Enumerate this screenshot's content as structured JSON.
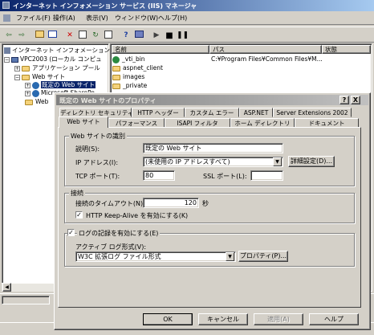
{
  "main_window": {
    "title": "インターネット インフォメーション サービス (IIS) マネージャ",
    "menu": [
      "ファイル(F)",
      "操作(A)",
      "表示(V)",
      "ウィンドウ(W)",
      "ヘルプ(H)"
    ],
    "tree": {
      "root": "インターネット インフォメーション サ",
      "computer": "VPC2003 (ローカル コンピュ",
      "app_pools": "アプリケーション プール",
      "web_sites": "Web サイト",
      "default_site": "既定の Web サイト",
      "sharepoint": "Microsoft SharePo",
      "web_ext": "Web"
    },
    "list_headers": [
      "名前",
      "パス",
      "状態"
    ],
    "list_rows": [
      {
        "name": "_vti_bin",
        "path": "C:¥Program Files¥Common Files¥M...",
        "status": ""
      },
      {
        "name": "aspnet_client",
        "path": "",
        "status": ""
      },
      {
        "name": "images",
        "path": "",
        "status": ""
      },
      {
        "name": "_private",
        "path": "",
        "status": ""
      }
    ]
  },
  "dialog": {
    "title": "既定の Web サイトのプロパティ",
    "help_btn": "?",
    "close_btn": "X",
    "tabs_back": [
      "ディレクトリ セキュリティ",
      "HTTP ヘッダー",
      "カスタム エラー",
      "ASP.NET",
      "Server Extensions 2002"
    ],
    "tabs_front": [
      "Web サイト",
      "パフォーマンス",
      "ISAPI フィルタ",
      "ホーム ディレクトリ",
      "ドキュメント"
    ],
    "identification": {
      "group": "Web サイトの識別",
      "desc_label": "説明(S):",
      "desc_value": "既定の Web サイト",
      "ip_label": "IP アドレス(I):",
      "ip_value": "(未使用の IP アドレスすべて)",
      "advanced_btn": "詳細設定(D)...",
      "tcp_label": "TCP ポート(T):",
      "tcp_value": "80",
      "ssl_label": "SSL ポート(L):",
      "ssl_value": ""
    },
    "connections": {
      "group": "接続",
      "timeout_label": "接続のタイムアウト(N):",
      "timeout_value": "120",
      "timeout_unit": "秒",
      "keepalive_label": "HTTP Keep-Alive を有効にする(K)",
      "keepalive_checked": true
    },
    "logging": {
      "enable_label": "ログの記録を有効にする(E)",
      "enabled": true,
      "format_label": "アクティブ ログ形式(V):",
      "format_value": "W3C 拡張ログ ファイル形式",
      "properties_btn": "プロパティ(P)..."
    },
    "buttons": {
      "ok": "OK",
      "cancel": "キャンセル",
      "apply": "適用(A)",
      "help": "ヘルプ"
    }
  }
}
